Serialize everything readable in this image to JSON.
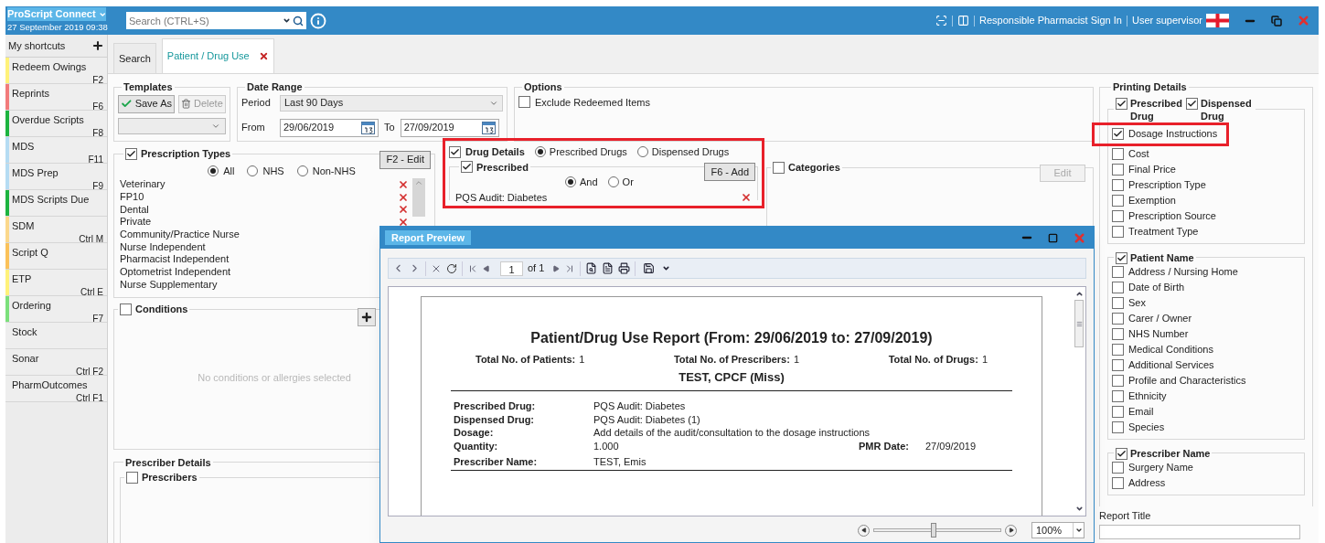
{
  "app": {
    "title": "ProScript Connect",
    "datetime": "27 September 2019 09:38",
    "search_placeholder": "Search (CTRL+S)",
    "links": [
      "Responsible Pharmacist Sign In",
      "User supervisor"
    ]
  },
  "sidebar": {
    "title": "My shortcuts",
    "items": [
      {
        "label": "Redeem Owings",
        "shortcut": "F2",
        "color": "#fff27a"
      },
      {
        "label": "Reprints",
        "shortcut": "F6",
        "color": "#f27b7b"
      },
      {
        "label": "Overdue Scripts",
        "shortcut": "F8",
        "color": "#1db440"
      },
      {
        "label": "MDS",
        "shortcut": "F11",
        "color": "#b5dcf3"
      },
      {
        "label": "MDS Prep",
        "shortcut": "F9",
        "color": "#b5dcf3"
      },
      {
        "label": "MDS Scripts Due",
        "color": "#1db440"
      },
      {
        "label": "SDM",
        "shortcut": "Ctrl M",
        "color": "#fbd88c"
      },
      {
        "label": "Script Q",
        "color": "#fbc25a"
      },
      {
        "label": "ETP",
        "shortcut": "Ctrl E",
        "color": "#fff27a"
      },
      {
        "label": "Ordering",
        "shortcut": "F7",
        "color": "#7be07b"
      },
      {
        "label": "Stock"
      },
      {
        "label": "Sonar",
        "shortcut": "Ctrl F2"
      },
      {
        "label": "PharmOutcomes",
        "shortcut": "Ctrl F1"
      }
    ]
  },
  "tabs": [
    {
      "label": "Search",
      "selected": false,
      "closable": false
    },
    {
      "label": "Patient / Drug Use",
      "selected": true,
      "closable": true
    }
  ],
  "templates": {
    "title": "Templates",
    "buttons": [
      {
        "label": "Save As",
        "kind": "save",
        "disabled": false
      },
      {
        "label": "Delete",
        "kind": "delete",
        "disabled": true
      }
    ]
  },
  "date_range": {
    "title": "Date Range",
    "period_label": "Period",
    "period": "Last 90 Days",
    "from_label": "From",
    "from": "29/06/2019",
    "to_label": "To",
    "to": "27/09/2019"
  },
  "options": {
    "title": "Options",
    "items": [
      {
        "label": "Exclude Redeemed Items",
        "checked": false
      }
    ]
  },
  "prescription_types": {
    "title": "Prescription Types",
    "checked": true,
    "edit_button": "F2 - Edit",
    "radios": [
      {
        "label": "All",
        "selected": true
      },
      {
        "label": "NHS",
        "selected": false
      },
      {
        "label": "Non-NHS",
        "selected": false
      }
    ],
    "items": [
      {
        "label": "Veterinary",
        "removable": true
      },
      {
        "label": "FP10",
        "removable": true
      },
      {
        "label": "Dental",
        "removable": true
      },
      {
        "label": "Private",
        "removable": true
      },
      {
        "label": "Community/Practice Nurse",
        "removable": false
      },
      {
        "label": "Nurse Independent",
        "removable": false
      },
      {
        "label": "Pharmacist Independent",
        "removable": false
      },
      {
        "label": "Optometrist Independent",
        "removable": false
      },
      {
        "label": "Nurse Supplementary",
        "removable": false
      }
    ]
  },
  "conditions": {
    "title": "Conditions",
    "checked": false,
    "empty_text": "No conditions or allergies selected"
  },
  "prescriber_details": {
    "title": "Prescriber Details",
    "prescribers": {
      "title": "Prescribers",
      "checked": false
    }
  },
  "drug_details": {
    "title": "Drug Details",
    "checked": true,
    "highlighted": true,
    "radios": [
      {
        "label": "Prescribed Drugs",
        "selected": true
      },
      {
        "label": "Dispensed Drugs",
        "selected": false
      }
    ],
    "prescribed": {
      "title": "Prescribed",
      "checked": true,
      "add_button": "F6 - Add",
      "logic": [
        {
          "label": "And",
          "selected": true
        },
        {
          "label": "Or",
          "selected": false
        }
      ],
      "drugs": [
        "PQS Audit: Diabetes"
      ]
    }
  },
  "categories": {
    "title": "Categories",
    "checked": false,
    "edit_button": "Edit",
    "edit_disabled": true
  },
  "printing_details": {
    "title": "Printing Details",
    "groups": [
      {
        "headers": [
          {
            "label": "Prescribed Drug",
            "checked": true
          },
          {
            "label": "Dispensed Drug",
            "checked": true
          }
        ],
        "items": [
          {
            "label": "Dosage Instructions",
            "checked": true,
            "highlighted": true
          },
          {
            "label": "Cost",
            "checked": false,
            "highlighted": false
          },
          {
            "label": "Final Price",
            "checked": false,
            "highlighted": false
          },
          {
            "label": "Prescription Type",
            "checked": false,
            "highlighted": false
          },
          {
            "label": "Exemption",
            "checked": false,
            "highlighted": false
          },
          {
            "label": "Prescription Source",
            "checked": false,
            "highlighted": false
          },
          {
            "label": "Treatment Type",
            "checked": false,
            "highlighted": false
          }
        ]
      },
      {
        "headers": [
          {
            "label": "Patient Name",
            "checked": true
          }
        ],
        "items": [
          {
            "label": "Address / Nursing Home",
            "checked": false,
            "highlighted": false
          },
          {
            "label": "Date of Birth",
            "checked": false,
            "highlighted": false
          },
          {
            "label": "Sex",
            "checked": false,
            "highlighted": false
          },
          {
            "label": "Carer / Owner",
            "checked": false,
            "highlighted": false
          },
          {
            "label": "NHS Number",
            "checked": false,
            "highlighted": false
          },
          {
            "label": "Medical Conditions",
            "checked": false,
            "highlighted": false
          },
          {
            "label": "Additional Services",
            "checked": false,
            "highlighted": false
          },
          {
            "label": "Profile and Characteristics",
            "checked": false,
            "highlighted": false
          },
          {
            "label": "Ethnicity",
            "checked": false,
            "highlighted": false
          },
          {
            "label": "Email",
            "checked": false,
            "highlighted": false
          },
          {
            "label": "Species",
            "checked": false,
            "highlighted": false
          }
        ]
      },
      {
        "headers": [
          {
            "label": "Prescriber Name",
            "checked": true
          }
        ],
        "items": [
          {
            "label": "Surgery Name",
            "checked": false,
            "highlighted": false
          },
          {
            "label": "Address",
            "checked": false,
            "highlighted": false
          }
        ]
      }
    ],
    "report_title_label": "Report Title"
  },
  "dialog": {
    "title": "Report Preview",
    "page": "1",
    "page_count": "of 1",
    "zoom": "100%",
    "zoom_slider": {
      "level": 0.47
    },
    "report": {
      "title": "Patient/Drug Use Report (From: 29/06/2019 to: 27/09/2019)",
      "totals": [
        {
          "label": "Total No. of Patients:",
          "value": "1"
        },
        {
          "label": "Total No. of Prescribers:",
          "value": "1"
        },
        {
          "label": "Total No. of Drugs:",
          "value": "1"
        }
      ],
      "patient": "TEST, CPCF (Miss)",
      "fields": [
        {
          "label": "Prescribed Drug:",
          "value": "PQS Audit: Diabetes"
        },
        {
          "label": "Dispensed Drug:",
          "value": "PQS Audit: Diabetes (1)"
        },
        {
          "label": "Dosage:",
          "value": "Add details of the audit/consultation to the dosage instructions"
        },
        {
          "label": "Quantity:",
          "value": "1.000",
          "extra_label": "PMR Date:",
          "extra_value": "27/09/2019"
        },
        {
          "label": "Prescriber Name:",
          "value": "TEST, Emis"
        }
      ]
    }
  }
}
